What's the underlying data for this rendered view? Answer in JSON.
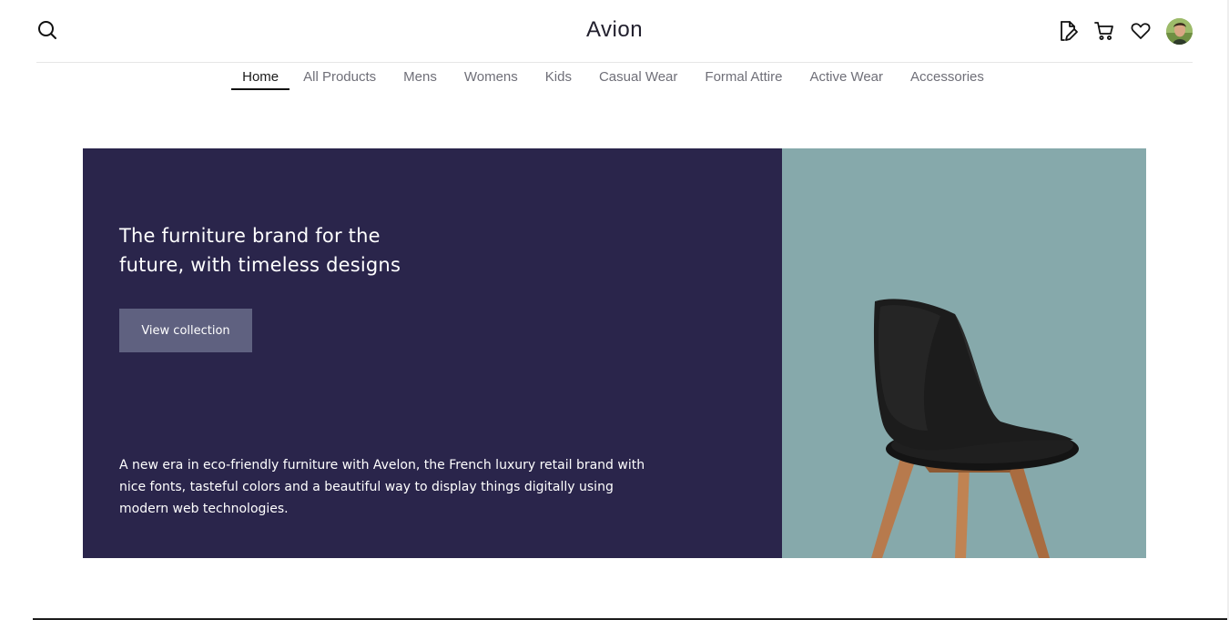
{
  "header": {
    "brand": "Avion",
    "icons": [
      "search-icon",
      "document-edit-icon",
      "cart-icon",
      "heart-icon",
      "avatar"
    ]
  },
  "nav": {
    "items": [
      {
        "label": "Home",
        "active": true
      },
      {
        "label": "All Products",
        "active": false
      },
      {
        "label": "Mens",
        "active": false
      },
      {
        "label": "Womens",
        "active": false
      },
      {
        "label": "Kids",
        "active": false
      },
      {
        "label": "Casual Wear",
        "active": false
      },
      {
        "label": "Formal Attire",
        "active": false
      },
      {
        "label": "Active Wear",
        "active": false
      },
      {
        "label": "Accessories",
        "active": false
      }
    ]
  },
  "hero": {
    "title": "The furniture brand for the future, with timeless designs",
    "cta_label": "View collection",
    "description": "A new era in eco-friendly furniture with Avelon, the French luxury retail brand with nice fonts, tasteful colors and a beautiful way to display things digitally using modern web technologies."
  },
  "colors": {
    "hero_bg": "#2a254b",
    "hero_image_bg": "#86a9ab",
    "cta_bg": "#5f6180"
  }
}
